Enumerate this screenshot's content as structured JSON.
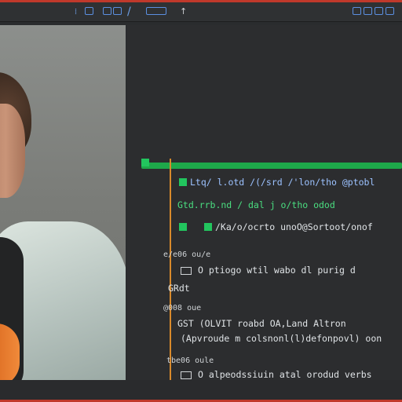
{
  "colors": {
    "frame": "#c0392b",
    "accent_blue": "#5b8fe0",
    "accent_green": "#1ea84a",
    "accent_orange": "#d98a2b"
  },
  "toolbar": {
    "icons": [
      "edit-icon",
      "settings-icon",
      "grid-icon",
      "slash-icon",
      "window-icon",
      "pin-icon"
    ],
    "window_controls": [
      "minimize-icon",
      "maximize-icon",
      "restore-icon",
      "close-icon"
    ]
  },
  "code": {
    "l1": "Ltq/ l.otd /(/srd /'lon/tho @ptobl",
    "l2": "Gtd.rrb.nd /  dal j o/tho odod",
    "l3": "/Ka/o/ocrto unoO@Sortoot/onof",
    "l4": "e/e06 ou/e",
    "l5": "O ptiogo wtil wabo dl purig d",
    "l6": "GRdt",
    "l7": "@008 oue",
    "l8": "GST (OLVIT roabd OA,Land Altron",
    "l9": "(Apvroude m colsnonl(l)defonpovl) oon",
    "l10": "tbe06 oule",
    "l11": "O alpeodssiuin atal orodud verbs"
  }
}
